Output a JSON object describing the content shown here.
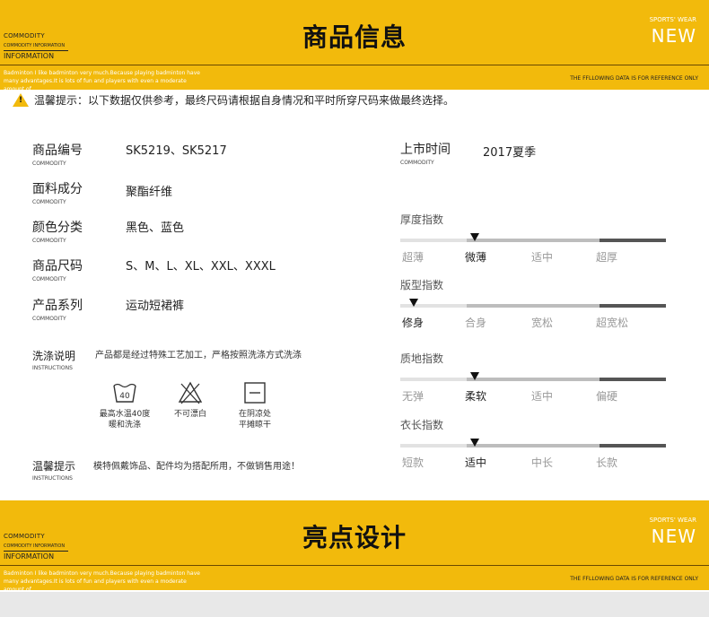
{
  "banner1": {
    "commodity": "COMMODITY",
    "commodity_info": "COMMODITY INFORMATION",
    "information": "INFORMATION",
    "title": "商品信息",
    "sports_wear": "SPORTS' WEAR",
    "new": "NEW",
    "sub_text": "Badminton I like badminton very much.Because playing badminton have many advantages.It is lots of fun and players with even a moderate amount of",
    "sub_right": "THE FFLLOWING DATA IS FOR REFERENCE ONLY"
  },
  "warning": {
    "label": "温馨提示：",
    "text": "以下数据仅供参考，最终尺码请根据自身情况和平时所穿尺码来做最终选择。"
  },
  "info": [
    {
      "zh": "商品编号",
      "en": "COMMODITY",
      "value": "SK5219、SK5217"
    },
    {
      "zh": "面料成分",
      "en": "COMMODITY",
      "value": "聚酯纤维"
    },
    {
      "zh": "颜色分类",
      "en": "COMMODITY",
      "value": "黑色、蓝色"
    },
    {
      "zh": "商品尺码",
      "en": "COMMODITY",
      "value": "S、M、L、XL、XXL、XXXL"
    },
    {
      "zh": "产品系列",
      "en": "COMMODITY",
      "value": "运动短裙裤"
    }
  ],
  "wash": {
    "zh": "洗涤说明",
    "en": "INSTRUCTIONS",
    "text": "产品都是经过特殊工艺加工，严格按照洗涤方式洗涤",
    "items": [
      {
        "icon": "wash-40-icon",
        "num": "40",
        "line1": "最高水温40度",
        "line2": "暖和洗涤"
      },
      {
        "icon": "no-bleach-icon",
        "line1": "不可漂白",
        "line2": ""
      },
      {
        "icon": "dry-flat-icon",
        "line1": "在阴凉处",
        "line2": "平摊晾干"
      }
    ]
  },
  "tip": {
    "zh": "温馨提示",
    "en": "INSTRUCTIONS",
    "text": "模特佩戴饰品、配件均为搭配所用，不做销售用途！"
  },
  "launch": {
    "zh": "上市时间",
    "en": "COMMODITY",
    "value": "2017夏季"
  },
  "indices": [
    {
      "name": "厚度指数",
      "options": [
        "超薄",
        "微薄",
        "适中",
        "超厚"
      ],
      "selected": 1
    },
    {
      "name": "版型指数",
      "options": [
        "修身",
        "合身",
        "宽松",
        "超宽松"
      ],
      "selected": 0
    },
    {
      "name": "质地指数",
      "options": [
        "无弹",
        "柔软",
        "适中",
        "偏硬"
      ],
      "selected": 1
    },
    {
      "name": "衣长指数",
      "options": [
        "短款",
        "适中",
        "中长",
        "长款"
      ],
      "selected": 1
    }
  ],
  "banner2": {
    "commodity": "COMMODITY",
    "commodity_info": "COMMODITY INFORMATION",
    "information": "INFORMATION",
    "title": "亮点设计",
    "sports_wear": "SPORTS' WEAR",
    "new": "NEW",
    "sub_text": "Badminton I like badminton very much.Because playing badminton have many advantages.It is lots of fun and players with even a moderate amount of",
    "sub_right": "THE FFLLOWING DATA IS FOR REFERENCE ONLY"
  },
  "colors": {
    "accent": "#f2ba0c",
    "bar_light": "#e2e2e2",
    "bar_mid": "#bdbdbd",
    "bar_dark": "#555555"
  }
}
